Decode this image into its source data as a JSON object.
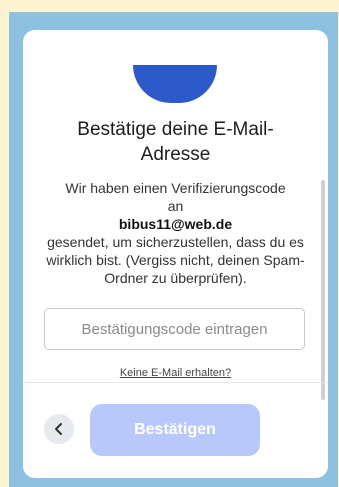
{
  "colors": {
    "background": "#fdf4d2",
    "frame": "#8ec0df",
    "logo": "#2e5ac9",
    "confirm_button": "#b9c8fb"
  },
  "dialog": {
    "title": "Bestätige deine E-Mail-Adresse",
    "desc_line1": "Wir haben einen Verifizierungscode",
    "desc_line2": "an",
    "email": "bibus11@web.de",
    "desc_line3": "gesendet, um sicherzustellen, dass du es wirklich bist. (Vergiss nicht, deinen Spam-Ordner zu überprüfen).",
    "code_placeholder": "Bestätigungscode eintragen",
    "resend_link": "Keine E-Mail erhalten?",
    "confirm_button": "Bestätigen"
  },
  "icons": {
    "back": "chevron-left-icon",
    "logo": "logo-icon"
  }
}
